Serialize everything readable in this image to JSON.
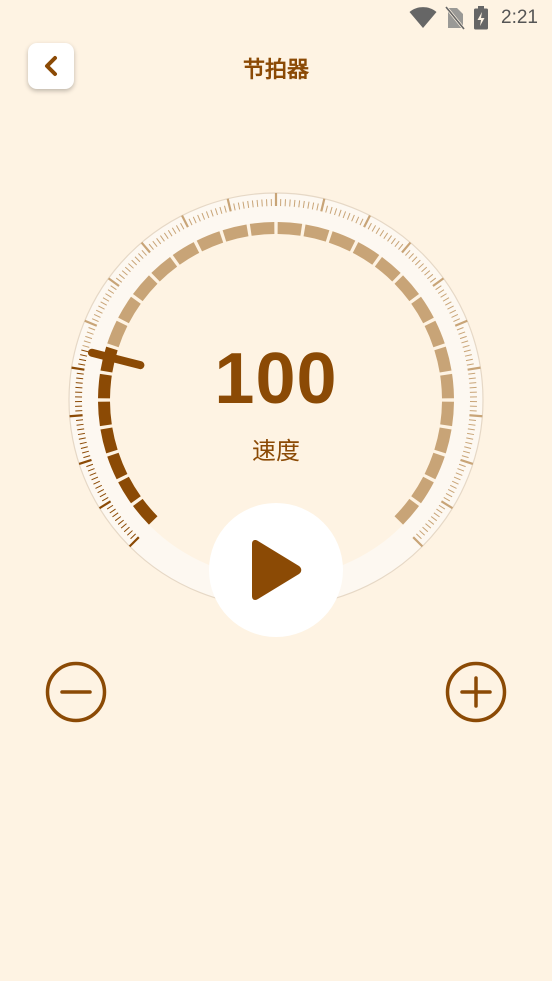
{
  "status_bar": {
    "time": "2:21",
    "icons": [
      "wifi-icon",
      "no-sim-icon",
      "battery-charging-icon"
    ]
  },
  "header": {
    "title": "节拍器",
    "back_icon": "chevron-left-icon"
  },
  "dial": {
    "bpm": "100",
    "label": "速度",
    "progress_fraction": 0.22
  },
  "controls": {
    "play_icon": "play-icon",
    "decrease_icon": "minus-circle-icon",
    "increase_icon": "plus-circle-icon"
  },
  "colors": {
    "background": "#FEF3E3",
    "accent": "#8B4A05",
    "track": "#C8A477",
    "dial_face": "#FEF3E3",
    "dial_ring": "#FDF8F1"
  }
}
